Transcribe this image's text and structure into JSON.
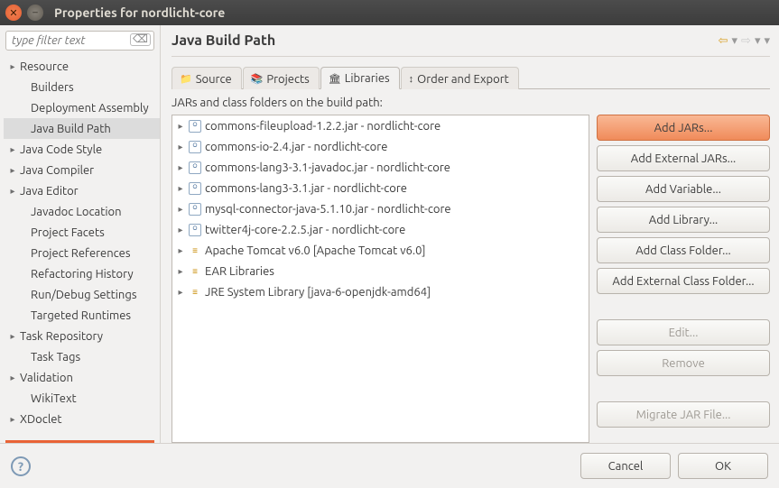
{
  "window": {
    "title": "Properties for nordlicht-core"
  },
  "filter": {
    "placeholder": "type filter text"
  },
  "tree": [
    {
      "label": "Resource",
      "expandable": true
    },
    {
      "label": "Builders",
      "expandable": false,
      "child": true
    },
    {
      "label": "Deployment Assembly",
      "expandable": false,
      "child": true
    },
    {
      "label": "Java Build Path",
      "expandable": false,
      "child": true,
      "selected": true
    },
    {
      "label": "Java Code Style",
      "expandable": true
    },
    {
      "label": "Java Compiler",
      "expandable": true
    },
    {
      "label": "Java Editor",
      "expandable": true
    },
    {
      "label": "Javadoc Location",
      "expandable": false,
      "child": true
    },
    {
      "label": "Project Facets",
      "expandable": false,
      "child": true
    },
    {
      "label": "Project References",
      "expandable": false,
      "child": true
    },
    {
      "label": "Refactoring History",
      "expandable": false,
      "child": true
    },
    {
      "label": "Run/Debug Settings",
      "expandable": false,
      "child": true
    },
    {
      "label": "Targeted Runtimes",
      "expandable": false,
      "child": true
    },
    {
      "label": "Task Repository",
      "expandable": true
    },
    {
      "label": "Task Tags",
      "expandable": false,
      "child": true
    },
    {
      "label": "Validation",
      "expandable": true
    },
    {
      "label": "WikiText",
      "expandable": false,
      "child": true
    },
    {
      "label": "XDoclet",
      "expandable": true
    }
  ],
  "page": {
    "title": "Java Build Path"
  },
  "tabs": [
    {
      "label": "Source",
      "icon": "📁",
      "active": false
    },
    {
      "label": "Projects",
      "icon": "📚",
      "active": false
    },
    {
      "label": "Libraries",
      "icon": "🏛",
      "active": true
    },
    {
      "label": "Order and Export",
      "icon": "↕",
      "active": false
    }
  ],
  "libraries": {
    "description": "JARs and class folders on the build path:",
    "entries": [
      {
        "label": "commons-fileupload-1.2.2.jar - nordlicht-core",
        "kind": "jar"
      },
      {
        "label": "commons-io-2.4.jar - nordlicht-core",
        "kind": "jar"
      },
      {
        "label": "commons-lang3-3.1-javadoc.jar - nordlicht-core",
        "kind": "jar"
      },
      {
        "label": "commons-lang3-3.1.jar - nordlicht-core",
        "kind": "jar"
      },
      {
        "label": "mysql-connector-java-5.1.10.jar - nordlicht-core",
        "kind": "jar"
      },
      {
        "label": "twitter4j-core-2.2.5.jar - nordlicht-core",
        "kind": "jar"
      },
      {
        "label": "Apache Tomcat v6.0 [Apache Tomcat v6.0]",
        "kind": "lib"
      },
      {
        "label": "EAR Libraries",
        "kind": "lib"
      },
      {
        "label": "JRE System Library [java-6-openjdk-amd64]",
        "kind": "lib"
      }
    ]
  },
  "buttons": {
    "add_jars": "Add JARs...",
    "add_external_jars": "Add External JARs...",
    "add_variable": "Add Variable...",
    "add_library": "Add Library...",
    "add_class_folder": "Add Class Folder...",
    "add_external_class_folder": "Add External Class Folder...",
    "edit": "Edit...",
    "remove": "Remove",
    "migrate": "Migrate JAR File..."
  },
  "footer": {
    "cancel": "Cancel",
    "ok": "OK"
  }
}
